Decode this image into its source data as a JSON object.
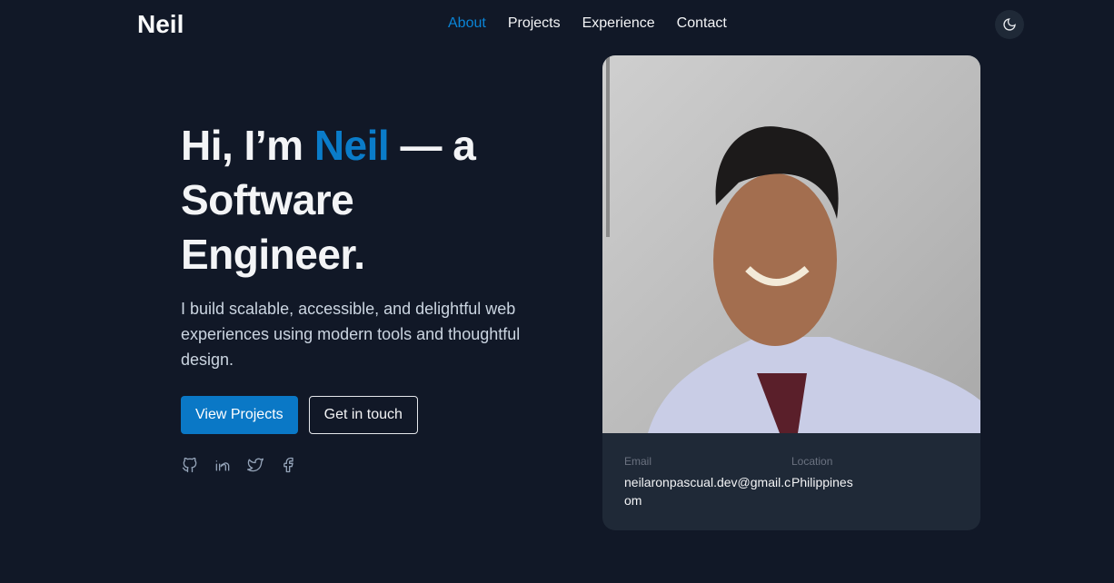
{
  "nav": {
    "logo": "Neil",
    "links": [
      "About",
      "Projects",
      "Experience",
      "Contact"
    ],
    "active": "About"
  },
  "hero": {
    "heading_pre": "Hi, I’m ",
    "heading_name": "Neil",
    "heading_post": " — a Software Engineer.",
    "description": "I build scalable, accessible, and delightful web experiences using modern tools and thoughtful design.",
    "primary_button": "View Projects",
    "secondary_button": "Get in touch"
  },
  "social": [
    "github-icon",
    "linkedin-icon",
    "twitter-icon",
    "facebook-icon"
  ],
  "card": {
    "email_label": "Email",
    "email": "neilaronpascual.dev@gmail.com",
    "location_label": "Location",
    "location": "Philippines"
  },
  "colors": {
    "background": "#111827",
    "accent": "#0a7cc9",
    "card": "#1f2937"
  }
}
